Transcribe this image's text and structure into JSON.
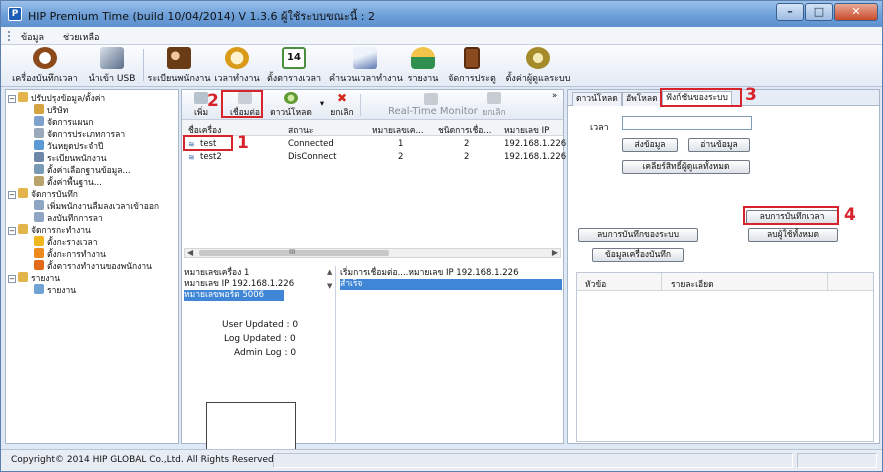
{
  "window": {
    "title": "HIP Premium Time (build 10/04/2014) V 1.3.6   ผู้ใช้ระบบขณะนี้ : 2",
    "minimize": "–",
    "maximize": "□",
    "close": "✕"
  },
  "menu": [
    "ข้อมูล",
    "ช่วยเหลือ"
  ],
  "toolbar": [
    {
      "label": "เครื่องบันทึกเวลา",
      "icon": "alarm-clock-icon",
      "color": "#8c4a1b"
    },
    {
      "label": "นำเข้า USB",
      "icon": "usb-icon",
      "color": "#5a6e88"
    },
    {
      "label": "ระเบียนพนักงาน",
      "icon": "users-icon",
      "color": "#6a3c16"
    },
    {
      "label": "เวลาทำงาน",
      "icon": "work-time-icon",
      "color": "#d99a1a"
    },
    {
      "label": "ตั้งตารางเวลา",
      "icon": "calendar-icon",
      "color": "#4b8f3e",
      "badge": "14"
    },
    {
      "label": "คำนวนเวลาทำงาน",
      "icon": "calculate-icon",
      "color": "#5c78b3"
    },
    {
      "label": "รายงาน",
      "icon": "report-icon",
      "color": "#2f8f4f"
    },
    {
      "label": "จัดการประตู",
      "icon": "door-icon",
      "color": "#8a4a1f"
    },
    {
      "label": "ตั้งค่าผู้ดูแลระบบ",
      "icon": "admin-settings-icon",
      "color": "#a58b2a"
    }
  ],
  "tree": [
    {
      "label": "ปรับปรุงข้อมูล/ตั้งค่า",
      "level": 0,
      "toggle": "−",
      "icon": "folder-icon"
    },
    {
      "label": "บริษัท",
      "level": 1,
      "icon": "company-icon"
    },
    {
      "label": "จัดการแผนก",
      "level": 1,
      "icon": "department-icon"
    },
    {
      "label": "จัดการประเภทการลา",
      "level": 1,
      "icon": "leave-type-icon"
    },
    {
      "label": "วันหยุดประจำปี",
      "level": 1,
      "icon": "holiday-icon"
    },
    {
      "label": "ระเบียนพนักงาน",
      "level": 1,
      "icon": "employee-icon"
    },
    {
      "label": "ตั้งค่าเลือกฐานข้อมูล...",
      "level": 1,
      "icon": "database-icon"
    },
    {
      "label": "ตั้งค่าพื้นฐาน...",
      "level": 1,
      "icon": "basic-settings-icon"
    },
    {
      "label": "จัดการบันทึก",
      "level": 0,
      "toggle": "−",
      "icon": "folder-icon"
    },
    {
      "label": "เพิ่มพนักงานลืมลงเวลาเข้าออก",
      "level": 1,
      "icon": "add-record-icon"
    },
    {
      "label": "ลงบันทึกการลา",
      "level": 1,
      "icon": "leave-record-icon"
    },
    {
      "label": "จัดการกะทำงาน",
      "level": 0,
      "toggle": "−",
      "icon": "folder-icon"
    },
    {
      "label": "ตั้งกะรางเวลา",
      "level": 1,
      "icon": "shift-1-icon"
    },
    {
      "label": "ตั้งกะการทำงาน",
      "level": 1,
      "icon": "shift-2-icon"
    },
    {
      "label": "ตั้งตารางทำงานของพนักงาน",
      "level": 1,
      "icon": "shift-3-icon"
    },
    {
      "label": "รายงาน",
      "level": 0,
      "toggle": "−",
      "icon": "folder-icon"
    },
    {
      "label": "รายงาน",
      "level": 1,
      "icon": "report-item-icon"
    }
  ],
  "subtoolbar": {
    "add": "เพิ่ม",
    "connect": "เชื่อมต่อ",
    "download": "ดาวน์โหลด",
    "cancel": "ยกเลิก",
    "realtime": "Real-Time Monitor",
    "disconnect": "ยกเลิก",
    "more": "»"
  },
  "devices": {
    "columns": [
      "ชื่อเครื่อง",
      "สถานะ",
      "หมายเลขเค...",
      "ชนิดการเชื่อ...",
      "หมายเลข IP"
    ],
    "rows": [
      {
        "name": "test",
        "status": "Connected",
        "number": "1",
        "type": "2",
        "ip": "192.168.1.226"
      },
      {
        "name": "test2",
        "status": "DisConnect",
        "number": "2",
        "type": "2",
        "ip": "192.168.1.226"
      }
    ]
  },
  "scroll": {
    "left": "◀",
    "right": "▶",
    "grip": "III"
  },
  "info": {
    "lines": [
      "หมายเลขเครื่อง  1",
      "หมายเลข IP   192.168.1.226",
      "หมายเลขพอร์ต  5006"
    ],
    "user_updated": "User Updated :  0",
    "log_updated": "Log Updated :  0",
    "admin_log": "Admin Log :  0"
  },
  "log": [
    "เริ่มการเชื่อมต่อ....หมายเลข IP   192.168.1.226",
    "สำเร็จ"
  ],
  "right": {
    "tabs": [
      "ดาวน์โหลด",
      "อัพโหลด",
      "ฟังก์ชันของระบบ"
    ],
    "time_label": "เวลา",
    "send_data": "ส่งข้อมูล",
    "read_data": "อ่านข้อมูล",
    "clear_admin": "เคลียร์สิทธิ์ผู้ดูแลทั้งหมด",
    "delete_time_records": "ลบการบันทึกเวลา",
    "delete_system_records": "ลบการบันทึกของระบบ",
    "delete_all_users": "ลบผู้ใช้ทั้งหมด",
    "device_info": "ข้อมูลเครื่องบันทึก",
    "grid_columns": [
      "หัวข้อ",
      "รายละเอียด"
    ]
  },
  "status": {
    "copyright": "Copyright© 2014 HIP GLOBAL Co.,Ltd. All Rights Reserved"
  },
  "annotations": [
    "1",
    "2",
    "3",
    "4"
  ],
  "colors": {
    "accent": "#3f86d6",
    "annotation": "#d7232b",
    "titlebar": "#6d9fd8"
  }
}
